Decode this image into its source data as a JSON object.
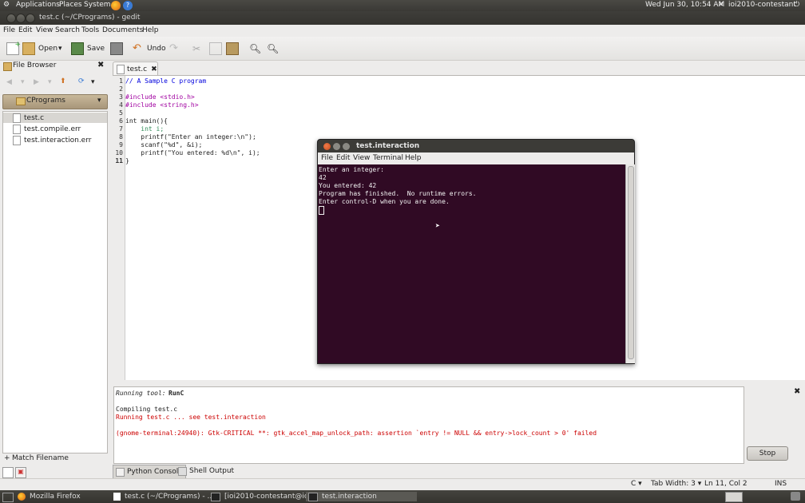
{
  "top_panel": {
    "applications": "Applications",
    "places": "Places",
    "system": "System",
    "datetime": "Wed Jun 30, 10:54 AM",
    "user": "ioi2010-contestant"
  },
  "window": {
    "title": "test.c (~/CPrograms) - gedit"
  },
  "menubar": [
    "File",
    "Edit",
    "View",
    "Search",
    "Tools",
    "Documents",
    "Help"
  ],
  "toolbar": {
    "open": "Open",
    "save": "Save",
    "undo": "Undo"
  },
  "side_panel": {
    "title": "File Browser",
    "folder": "CPrograms",
    "files": [
      "test.c",
      "test.compile.err",
      "test.interaction.err"
    ],
    "filter": "Match Filename"
  },
  "editor": {
    "tab": "test.c",
    "lines": [
      "// A Sample C program",
      "",
      "#include <stdio.h>",
      "#include <string.h>",
      "",
      "int main(){",
      "    int i;",
      "    printf(\"Enter an integer:\\n\");",
      "    scanf(\"%d\", &i);",
      "    printf(\"You entered: %d\\n\", i);",
      "}"
    ],
    "line_numbers": [
      "1",
      "2",
      "3",
      "4",
      "5",
      "6",
      "7",
      "8",
      "9",
      "10",
      "11"
    ]
  },
  "shell": {
    "running_prefix": "Running tool:",
    "running_tool": "RunC",
    "compiling": "Compiling test.c",
    "running": "Running test.c ... see test.interaction",
    "error": "(gnome-terminal:24940): Gtk-CRITICAL **: gtk_accel_map_unlock_path: assertion `entry != NULL && entry->lock_count > 0' failed",
    "stop": "Stop"
  },
  "bottom_tabs": [
    "Python Console",
    "Shell Output"
  ],
  "statusbar": {
    "lang": "C",
    "tab_width": "Tab Width:  3",
    "position": "Ln 11, Col 2",
    "mode": "INS"
  },
  "taskbar": [
    "Mozilla Firefox",
    "test.c (~/CPrograms) - ...",
    "[ioi2010-contestant@io...",
    "test.interaction"
  ],
  "terminal": {
    "title": "test.interaction",
    "menu": [
      "File",
      "Edit",
      "View",
      "Terminal",
      "Help"
    ],
    "lines": [
      "Enter an integer:",
      "42",
      "You entered: 42",
      "Program has finished.  No runtime errors.",
      "Enter control-D when you are done."
    ]
  },
  "colors": {
    "terminal_bg": "#300a24",
    "error_red": "#cc0000",
    "comment_blue": "#0000dd",
    "preproc_magenta": "#a000a0",
    "string_magenta": "#ff00ff",
    "type_green": "#2e8b57"
  }
}
